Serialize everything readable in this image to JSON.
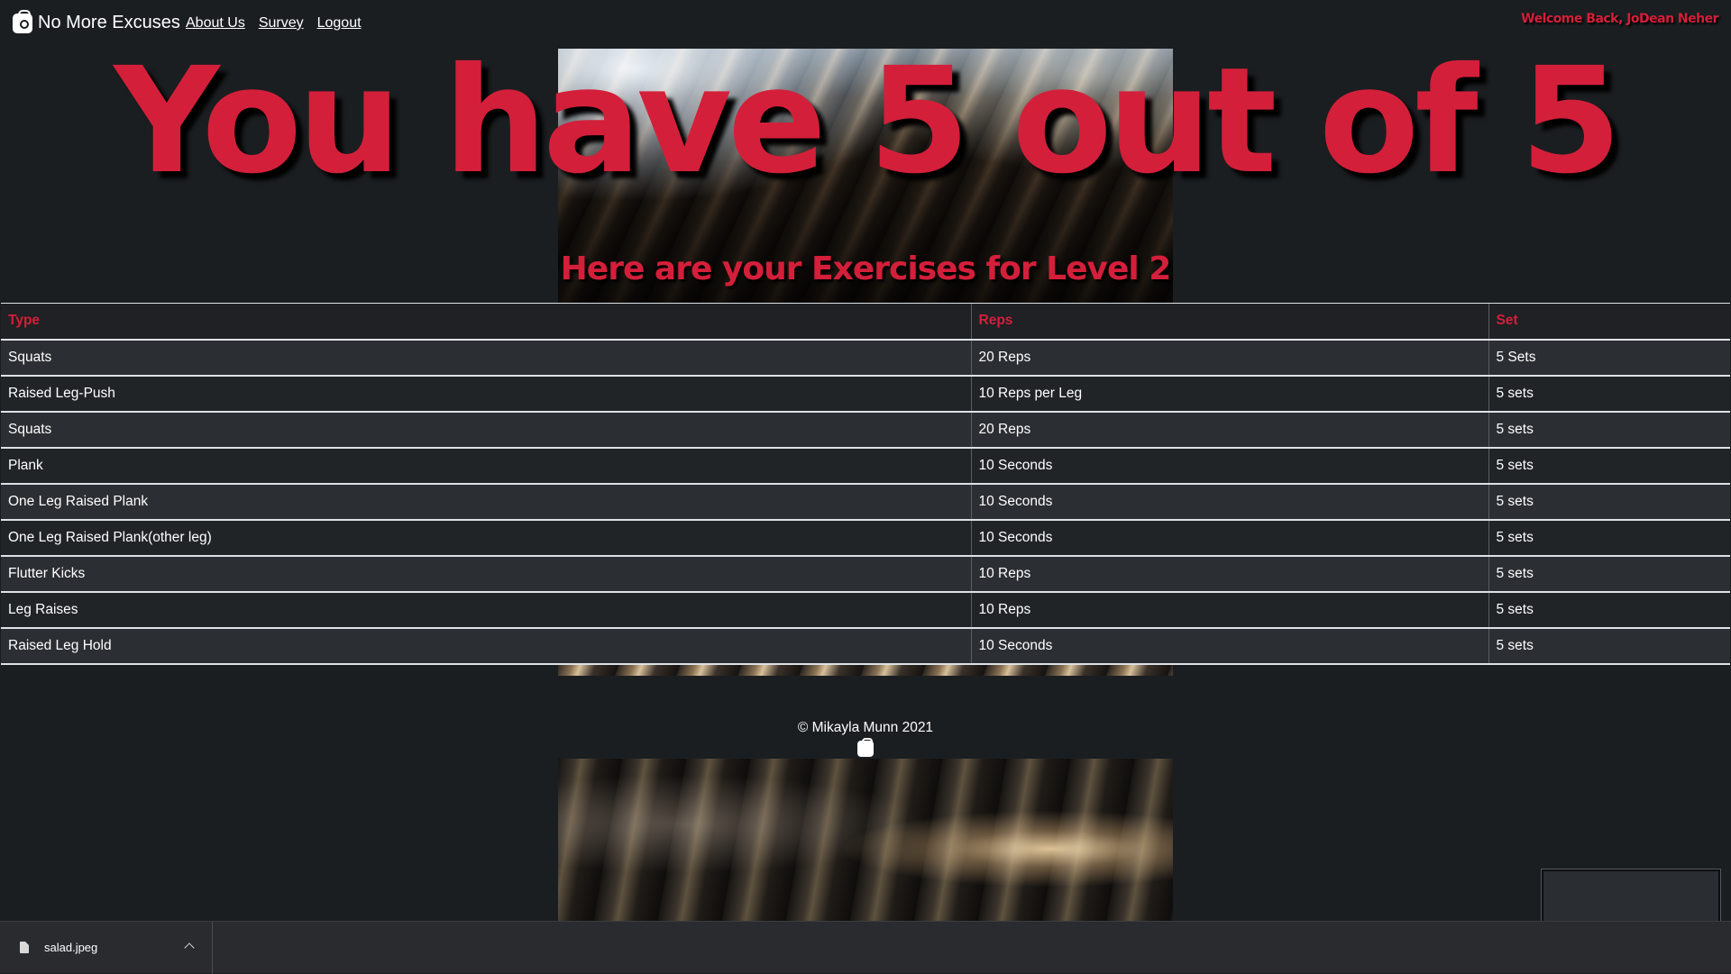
{
  "navbar": {
    "brand": "No More Excuses",
    "links": [
      "About Us",
      "Survey",
      "Logout"
    ],
    "welcome": "Welcome Back, JoDean Neher"
  },
  "hero": {
    "title": "You have 5 out of 5",
    "subtitle": "Here are your Exercises for Level 2"
  },
  "table": {
    "headers": [
      "Type",
      "Reps",
      "Set"
    ],
    "rows": [
      [
        "Squats",
        "20 Reps",
        "5 Sets"
      ],
      [
        "Raised Leg-Push",
        "10 Reps per Leg",
        "5 sets"
      ],
      [
        "Squats",
        "20 Reps",
        "5 sets"
      ],
      [
        "Plank",
        "10 Seconds",
        "5 sets"
      ],
      [
        "One Leg Raised Plank",
        "10 Seconds",
        "5 sets"
      ],
      [
        "One Leg Raised Plank(other leg)",
        "10 Seconds",
        "5 sets"
      ],
      [
        "Flutter Kicks",
        "10 Reps",
        "5 sets"
      ],
      [
        "Leg Raises",
        "10 Reps",
        "5 sets"
      ],
      [
        "Raised Leg Hold",
        "10 Seconds",
        "5 sets"
      ]
    ]
  },
  "footer": {
    "copyright": "© Mikayla Munn 2021"
  },
  "download_bar": {
    "file_name": "salad.jpeg"
  },
  "colors": {
    "accent": "#d41f3a",
    "background": "#1b1e21",
    "row_dark": "#212427",
    "row_light": "#2b2e32"
  },
  "icons": [
    "shopping-bag-icon",
    "file-icon",
    "chevron-up-icon"
  ]
}
